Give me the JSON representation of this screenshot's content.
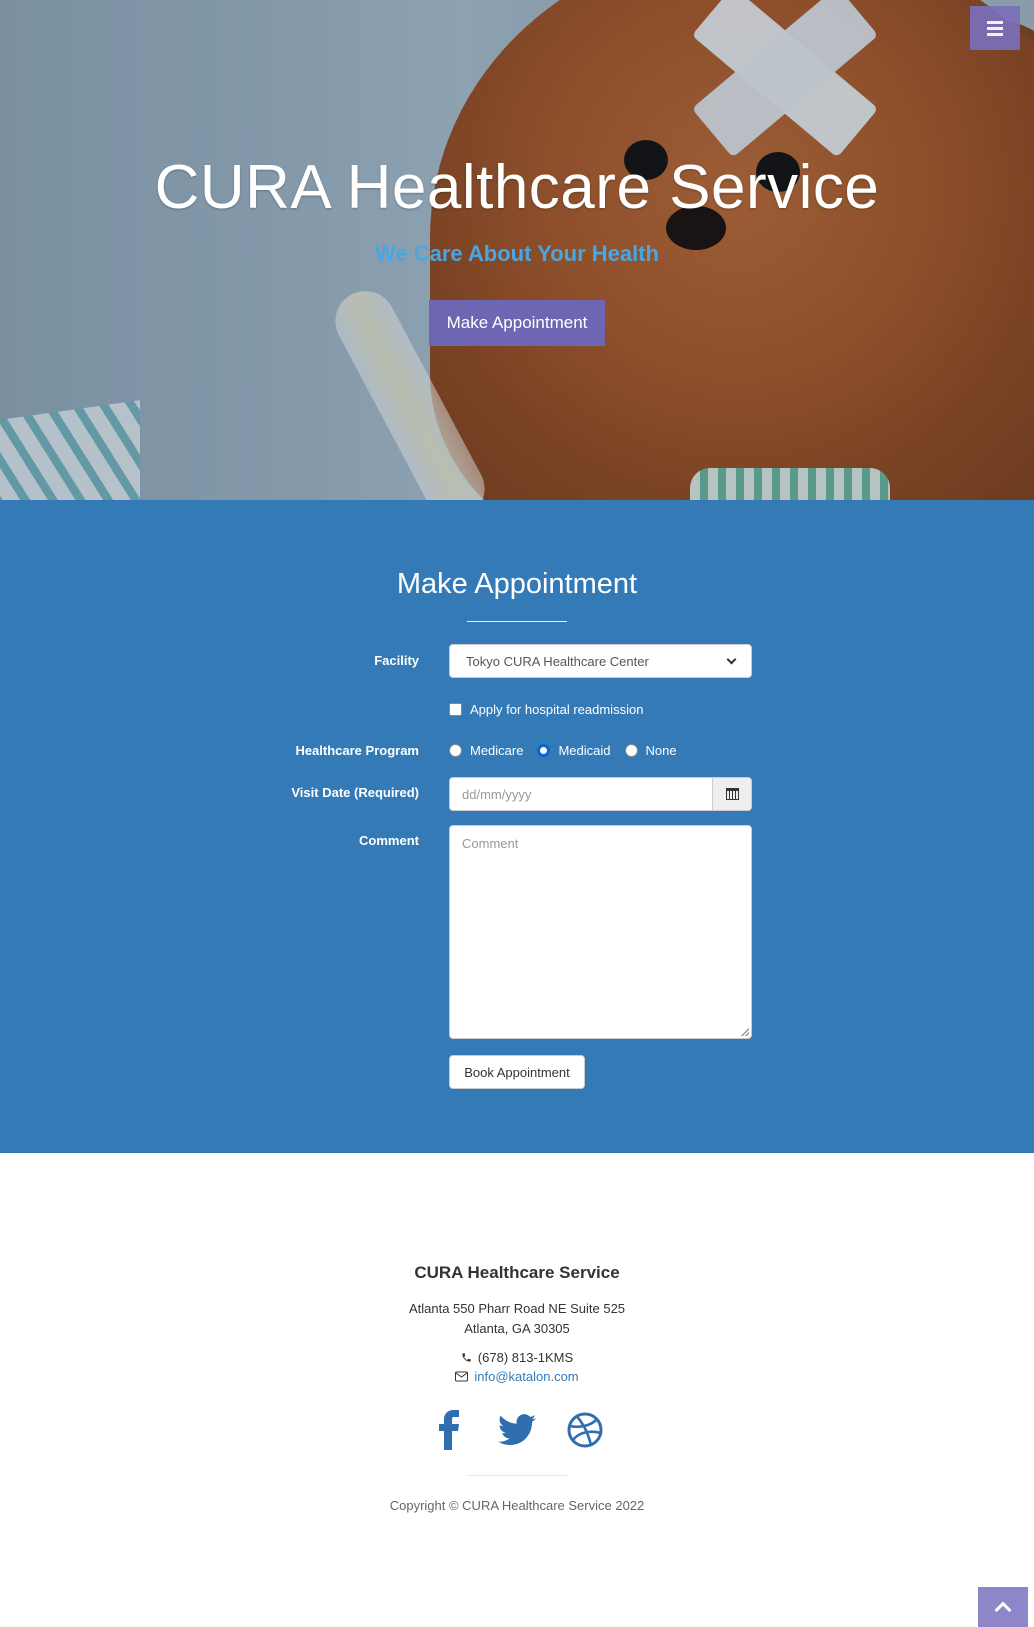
{
  "hero": {
    "title": "CURA Healthcare Service",
    "subtitle": "We Care About Your Health",
    "button": "Make Appointment"
  },
  "menu": {
    "icon": "bars-icon"
  },
  "appointment": {
    "title": "Make Appointment",
    "facility": {
      "label": "Facility",
      "value": "Tokyo CURA Healthcare Center"
    },
    "readmission": {
      "label": "Apply for hospital readmission",
      "checked": false
    },
    "program": {
      "label": "Healthcare Program",
      "options": [
        "Medicare",
        "Medicaid",
        "None"
      ],
      "selected": "Medicaid"
    },
    "visit_date": {
      "label": "Visit Date (Required)",
      "placeholder": "dd/mm/yyyy"
    },
    "comment": {
      "label": "Comment",
      "placeholder": "Comment"
    },
    "book_button": "Book Appointment"
  },
  "footer": {
    "title": "CURA Healthcare Service",
    "address_line1": "Atlanta 550 Pharr Road NE Suite 525",
    "address_line2": "Atlanta, GA 30305",
    "phone": "(678) 813-1KMS",
    "email": "info@katalon.com",
    "social": [
      "facebook-icon",
      "twitter-icon",
      "dribbble-icon"
    ],
    "copyright": "Copyright © CURA Healthcare Service 2022"
  },
  "colors": {
    "primary": "#337ab7",
    "accent": "#6e66b3",
    "subtitle": "#4aa6e0"
  }
}
